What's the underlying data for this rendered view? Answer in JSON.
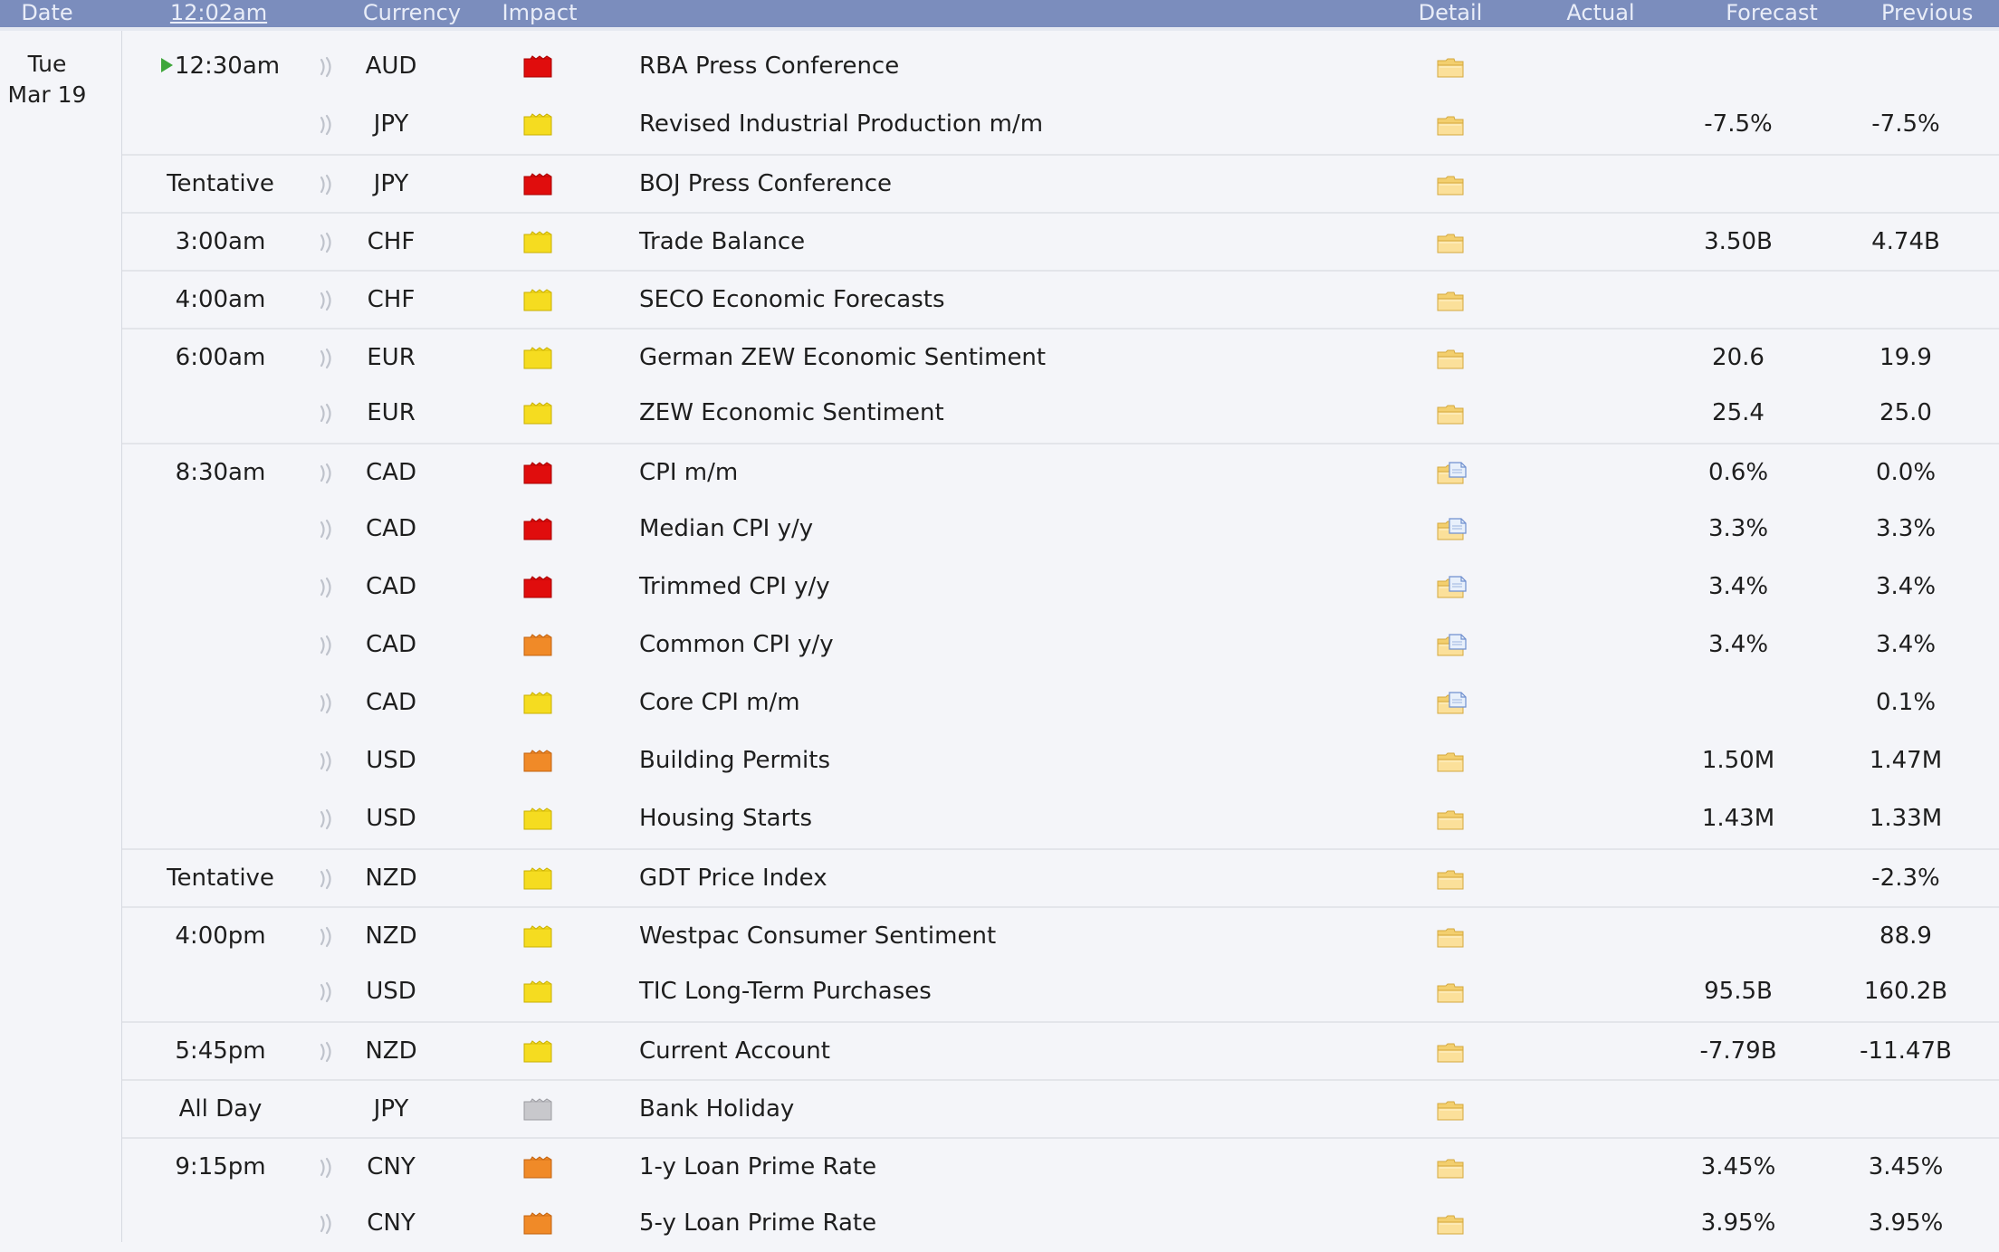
{
  "header": {
    "date": "Date",
    "time": "12:02am",
    "currency": "Currency",
    "impact": "Impact",
    "detail": "Detail",
    "actual": "Actual",
    "forecast": "Forecast",
    "previous": "Previous"
  },
  "date": {
    "weekday": "Tue",
    "day": "Mar 19"
  },
  "colors": {
    "high": "#e00d0d",
    "medium": "#f08a28",
    "low": "#f5dc20",
    "holiday": "#c8c8cc",
    "header_bg": "#7b8dbd"
  },
  "rows": [
    {
      "time": "12:30am",
      "current": true,
      "currency": "AUD",
      "impact": "high",
      "event": "RBA Press Conference",
      "detail": "folder-icon",
      "forecast": "",
      "previous": ""
    },
    {
      "time": "",
      "currency": "JPY",
      "impact": "low",
      "event": "Revised Industrial Production m/m",
      "detail": "folder-icon",
      "forecast": "-7.5%",
      "previous": "-7.5%"
    },
    {
      "time": "Tentative",
      "currency": "JPY",
      "impact": "high",
      "event": "BOJ Press Conference",
      "detail": "folder-icon",
      "forecast": "",
      "previous": ""
    },
    {
      "time": "3:00am",
      "currency": "CHF",
      "impact": "low",
      "event": "Trade Balance",
      "detail": "folder-icon",
      "forecast": "3.50B",
      "previous": "4.74B"
    },
    {
      "time": "4:00am",
      "currency": "CHF",
      "impact": "low",
      "event": "SECO Economic Forecasts",
      "detail": "folder-icon",
      "forecast": "",
      "previous": ""
    },
    {
      "time": "6:00am",
      "currency": "EUR",
      "impact": "low",
      "event": "German ZEW Economic Sentiment",
      "detail": "folder-icon",
      "forecast": "20.6",
      "previous": "19.9"
    },
    {
      "time": "",
      "currency": "EUR",
      "impact": "low",
      "event": "ZEW Economic Sentiment",
      "detail": "folder-icon",
      "forecast": "25.4",
      "previous": "25.0"
    },
    {
      "time": "8:30am",
      "currency": "CAD",
      "impact": "high",
      "event": "CPI m/m",
      "detail": "folder-doc-icon",
      "forecast": "0.6%",
      "previous": "0.0%"
    },
    {
      "time": "",
      "currency": "CAD",
      "impact": "high",
      "event": "Median CPI y/y",
      "detail": "folder-doc-icon",
      "forecast": "3.3%",
      "previous": "3.3%"
    },
    {
      "time": "",
      "currency": "CAD",
      "impact": "high",
      "event": "Trimmed CPI y/y",
      "detail": "folder-doc-icon",
      "forecast": "3.4%",
      "previous": "3.4%"
    },
    {
      "time": "",
      "currency": "CAD",
      "impact": "medium",
      "event": "Common CPI y/y",
      "detail": "folder-doc-icon",
      "forecast": "3.4%",
      "previous": "3.4%"
    },
    {
      "time": "",
      "currency": "CAD",
      "impact": "low",
      "event": "Core CPI m/m",
      "detail": "folder-doc-icon",
      "forecast": "",
      "previous": "0.1%"
    },
    {
      "time": "",
      "currency": "USD",
      "impact": "medium",
      "event": "Building Permits",
      "detail": "folder-icon",
      "forecast": "1.50M",
      "previous": "1.47M"
    },
    {
      "time": "",
      "currency": "USD",
      "impact": "low",
      "event": "Housing Starts",
      "detail": "folder-icon",
      "forecast": "1.43M",
      "previous": "1.33M"
    },
    {
      "time": "Tentative",
      "currency": "NZD",
      "impact": "low",
      "event": "GDT Price Index",
      "detail": "folder-icon",
      "forecast": "",
      "previous": "-2.3%"
    },
    {
      "time": "4:00pm",
      "currency": "NZD",
      "impact": "low",
      "event": "Westpac Consumer Sentiment",
      "detail": "folder-icon",
      "forecast": "",
      "previous": "88.9"
    },
    {
      "time": "",
      "currency": "USD",
      "impact": "low",
      "event": "TIC Long-Term Purchases",
      "detail": "folder-icon",
      "forecast": "95.5B",
      "previous": "160.2B"
    },
    {
      "time": "5:45pm",
      "currency": "NZD",
      "impact": "low",
      "event": "Current Account",
      "detail": "folder-icon",
      "forecast": "-7.79B",
      "previous": "-11.47B"
    },
    {
      "time": "All Day",
      "currency": "JPY",
      "impact": "holiday",
      "noSound": true,
      "event": "Bank Holiday",
      "detail": "folder-icon",
      "forecast": "",
      "previous": ""
    },
    {
      "time": "9:15pm",
      "currency": "CNY",
      "impact": "medium",
      "event": "1-y Loan Prime Rate",
      "detail": "folder-icon",
      "forecast": "3.45%",
      "previous": "3.45%"
    },
    {
      "time": "",
      "currency": "CNY",
      "impact": "medium",
      "event": "5-y Loan Prime Rate",
      "detail": "folder-icon",
      "forecast": "3.95%",
      "previous": "3.95%"
    }
  ]
}
